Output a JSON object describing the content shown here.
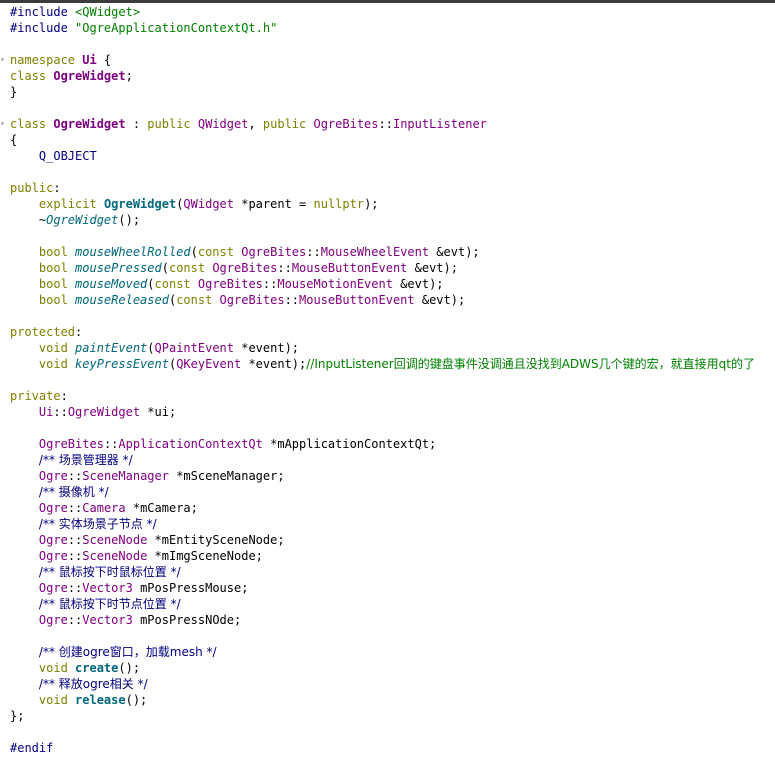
{
  "editor": {
    "lines": [
      {
        "tokens": [
          [
            "pp",
            "#include "
          ],
          [
            "str",
            "<QWidget>"
          ]
        ]
      },
      {
        "tokens": [
          [
            "pp",
            "#include "
          ],
          [
            "str",
            "\"OgreApplicationContextQt.h\""
          ]
        ]
      },
      {
        "tokens": []
      },
      {
        "tokens": [
          [
            "kw",
            "namespace "
          ],
          [
            "cls",
            "Ui"
          ],
          [
            "plain",
            " {"
          ]
        ],
        "fold": true
      },
      {
        "tokens": [
          [
            "kw",
            "class "
          ],
          [
            "cls",
            "OgreWidget"
          ],
          [
            "plain",
            ";"
          ]
        ]
      },
      {
        "tokens": [
          [
            "plain",
            "}"
          ]
        ]
      },
      {
        "tokens": []
      },
      {
        "tokens": [
          [
            "kw",
            "class "
          ],
          [
            "cls",
            "OgreWidget"
          ],
          [
            "plain",
            " : "
          ],
          [
            "kw",
            "public "
          ],
          [
            "type",
            "QWidget"
          ],
          [
            "plain",
            ", "
          ],
          [
            "kw",
            "public "
          ],
          [
            "type",
            "OgreBites"
          ],
          [
            "plain",
            "::"
          ],
          [
            "type",
            "InputListener"
          ]
        ],
        "fold": true
      },
      {
        "tokens": [
          [
            "plain",
            "{"
          ]
        ]
      },
      {
        "tokens": [
          [
            "plain",
            "    "
          ],
          [
            "obj",
            "Q_OBJECT"
          ]
        ]
      },
      {
        "tokens": []
      },
      {
        "tokens": [
          [
            "kw",
            "public"
          ],
          [
            "plain",
            ":"
          ]
        ]
      },
      {
        "tokens": [
          [
            "plain",
            "    "
          ],
          [
            "kw",
            "explicit "
          ],
          [
            "bold",
            "OgreWidget"
          ],
          [
            "plain",
            "("
          ],
          [
            "type",
            "QWidget"
          ],
          [
            "plain",
            " *parent = "
          ],
          [
            "kw",
            "nullptr"
          ],
          [
            "plain",
            ");"
          ]
        ]
      },
      {
        "tokens": [
          [
            "plain",
            "    ~"
          ],
          [
            "fn",
            "OgreWidget"
          ],
          [
            "plain",
            "();"
          ]
        ]
      },
      {
        "tokens": []
      },
      {
        "tokens": [
          [
            "plain",
            "    "
          ],
          [
            "kw",
            "bool "
          ],
          [
            "fn",
            "mouseWheelRolled"
          ],
          [
            "plain",
            "("
          ],
          [
            "kw",
            "const "
          ],
          [
            "type",
            "OgreBites"
          ],
          [
            "plain",
            "::"
          ],
          [
            "type",
            "MouseWheelEvent"
          ],
          [
            "plain",
            " &evt);"
          ]
        ]
      },
      {
        "tokens": [
          [
            "plain",
            "    "
          ],
          [
            "kw",
            "bool "
          ],
          [
            "fn",
            "mousePressed"
          ],
          [
            "plain",
            "("
          ],
          [
            "kw",
            "const "
          ],
          [
            "type",
            "OgreBites"
          ],
          [
            "plain",
            "::"
          ],
          [
            "type",
            "MouseButtonEvent"
          ],
          [
            "plain",
            " &evt);"
          ]
        ]
      },
      {
        "tokens": [
          [
            "plain",
            "    "
          ],
          [
            "kw",
            "bool "
          ],
          [
            "fn",
            "mouseMoved"
          ],
          [
            "plain",
            "("
          ],
          [
            "kw",
            "const "
          ],
          [
            "type",
            "OgreBites"
          ],
          [
            "plain",
            "::"
          ],
          [
            "type",
            "MouseMotionEvent"
          ],
          [
            "plain",
            " &evt);"
          ]
        ]
      },
      {
        "tokens": [
          [
            "plain",
            "    "
          ],
          [
            "kw",
            "bool "
          ],
          [
            "fn",
            "mouseReleased"
          ],
          [
            "plain",
            "("
          ],
          [
            "kw",
            "const "
          ],
          [
            "type",
            "OgreBites"
          ],
          [
            "plain",
            "::"
          ],
          [
            "type",
            "MouseButtonEvent"
          ],
          [
            "plain",
            " &evt);"
          ]
        ]
      },
      {
        "tokens": []
      },
      {
        "tokens": [
          [
            "kw",
            "protected"
          ],
          [
            "plain",
            ":"
          ]
        ]
      },
      {
        "tokens": [
          [
            "plain",
            "    "
          ],
          [
            "kw",
            "void "
          ],
          [
            "fn",
            "paintEvent"
          ],
          [
            "plain",
            "("
          ],
          [
            "type",
            "QPaintEvent"
          ],
          [
            "plain",
            " *event);"
          ]
        ]
      },
      {
        "tokens": [
          [
            "plain",
            "    "
          ],
          [
            "kw",
            "void "
          ],
          [
            "fn",
            "keyPressEvent"
          ],
          [
            "plain",
            "("
          ],
          [
            "type",
            "QKeyEvent"
          ],
          [
            "plain",
            " *event);"
          ],
          [
            "cmt2cjk",
            "//InputListener回调的键盘事件没调通且没找到ADWS几个键的宏，就直接用qt的了"
          ]
        ]
      },
      {
        "tokens": []
      },
      {
        "tokens": [
          [
            "kw",
            "private"
          ],
          [
            "plain",
            ":"
          ]
        ]
      },
      {
        "tokens": [
          [
            "plain",
            "    "
          ],
          [
            "type",
            "Ui"
          ],
          [
            "plain",
            "::"
          ],
          [
            "type",
            "OgreWidget"
          ],
          [
            "plain",
            " *ui;"
          ]
        ]
      },
      {
        "tokens": []
      },
      {
        "tokens": [
          [
            "plain",
            "    "
          ],
          [
            "type",
            "OgreBites"
          ],
          [
            "plain",
            "::"
          ],
          [
            "type",
            "ApplicationContextQt"
          ],
          [
            "plain",
            " *mApplicationContextQt;"
          ]
        ]
      },
      {
        "tokens": [
          [
            "plain",
            "    "
          ],
          [
            "cmtcjk",
            "/** 场景管理器 */"
          ]
        ]
      },
      {
        "tokens": [
          [
            "plain",
            "    "
          ],
          [
            "type",
            "Ogre"
          ],
          [
            "plain",
            "::"
          ],
          [
            "type",
            "SceneManager"
          ],
          [
            "plain",
            " *mSceneManager;"
          ]
        ]
      },
      {
        "tokens": [
          [
            "plain",
            "    "
          ],
          [
            "cmtcjk",
            "/** 摄像机 */"
          ]
        ]
      },
      {
        "tokens": [
          [
            "plain",
            "    "
          ],
          [
            "type",
            "Ogre"
          ],
          [
            "plain",
            "::"
          ],
          [
            "type",
            "Camera"
          ],
          [
            "plain",
            " *mCamera;"
          ]
        ]
      },
      {
        "tokens": [
          [
            "plain",
            "    "
          ],
          [
            "cmtcjk",
            "/** 实体场景子节点 */"
          ]
        ]
      },
      {
        "tokens": [
          [
            "plain",
            "    "
          ],
          [
            "type",
            "Ogre"
          ],
          [
            "plain",
            "::"
          ],
          [
            "type",
            "SceneNode"
          ],
          [
            "plain",
            " *mEntitySceneNode;"
          ]
        ]
      },
      {
        "tokens": [
          [
            "plain",
            "    "
          ],
          [
            "type",
            "Ogre"
          ],
          [
            "plain",
            "::"
          ],
          [
            "type",
            "SceneNode"
          ],
          [
            "plain",
            " *mImgSceneNode;"
          ]
        ]
      },
      {
        "tokens": [
          [
            "plain",
            "    "
          ],
          [
            "cmtcjk",
            "/** 鼠标按下时鼠标位置 */"
          ]
        ]
      },
      {
        "tokens": [
          [
            "plain",
            "    "
          ],
          [
            "type",
            "Ogre"
          ],
          [
            "plain",
            "::"
          ],
          [
            "type",
            "Vector3"
          ],
          [
            "plain",
            " mPosPressMouse;"
          ]
        ]
      },
      {
        "tokens": [
          [
            "plain",
            "    "
          ],
          [
            "cmtcjk",
            "/** 鼠标按下时节点位置 */"
          ]
        ]
      },
      {
        "tokens": [
          [
            "plain",
            "    "
          ],
          [
            "type",
            "Ogre"
          ],
          [
            "plain",
            "::"
          ],
          [
            "type",
            "Vector3"
          ],
          [
            "plain",
            " mPosPressNOde;"
          ]
        ]
      },
      {
        "tokens": []
      },
      {
        "tokens": [
          [
            "plain",
            "    "
          ],
          [
            "cmtcjk",
            "/** 创建ogre窗口，加载mesh */"
          ]
        ]
      },
      {
        "tokens": [
          [
            "plain",
            "    "
          ],
          [
            "kw",
            "void "
          ],
          [
            "bold",
            "create"
          ],
          [
            "plain",
            "();"
          ]
        ]
      },
      {
        "tokens": [
          [
            "plain",
            "    "
          ],
          [
            "cmtcjk",
            "/** 释放ogre相关 */"
          ]
        ]
      },
      {
        "tokens": [
          [
            "plain",
            "    "
          ],
          [
            "kw",
            "void "
          ],
          [
            "bold",
            "release"
          ],
          [
            "plain",
            "();"
          ]
        ]
      },
      {
        "tokens": [
          [
            "plain",
            "};"
          ]
        ]
      },
      {
        "tokens": []
      },
      {
        "tokens": [
          [
            "pp",
            "#endif"
          ]
        ]
      },
      {
        "tokens": []
      }
    ]
  }
}
